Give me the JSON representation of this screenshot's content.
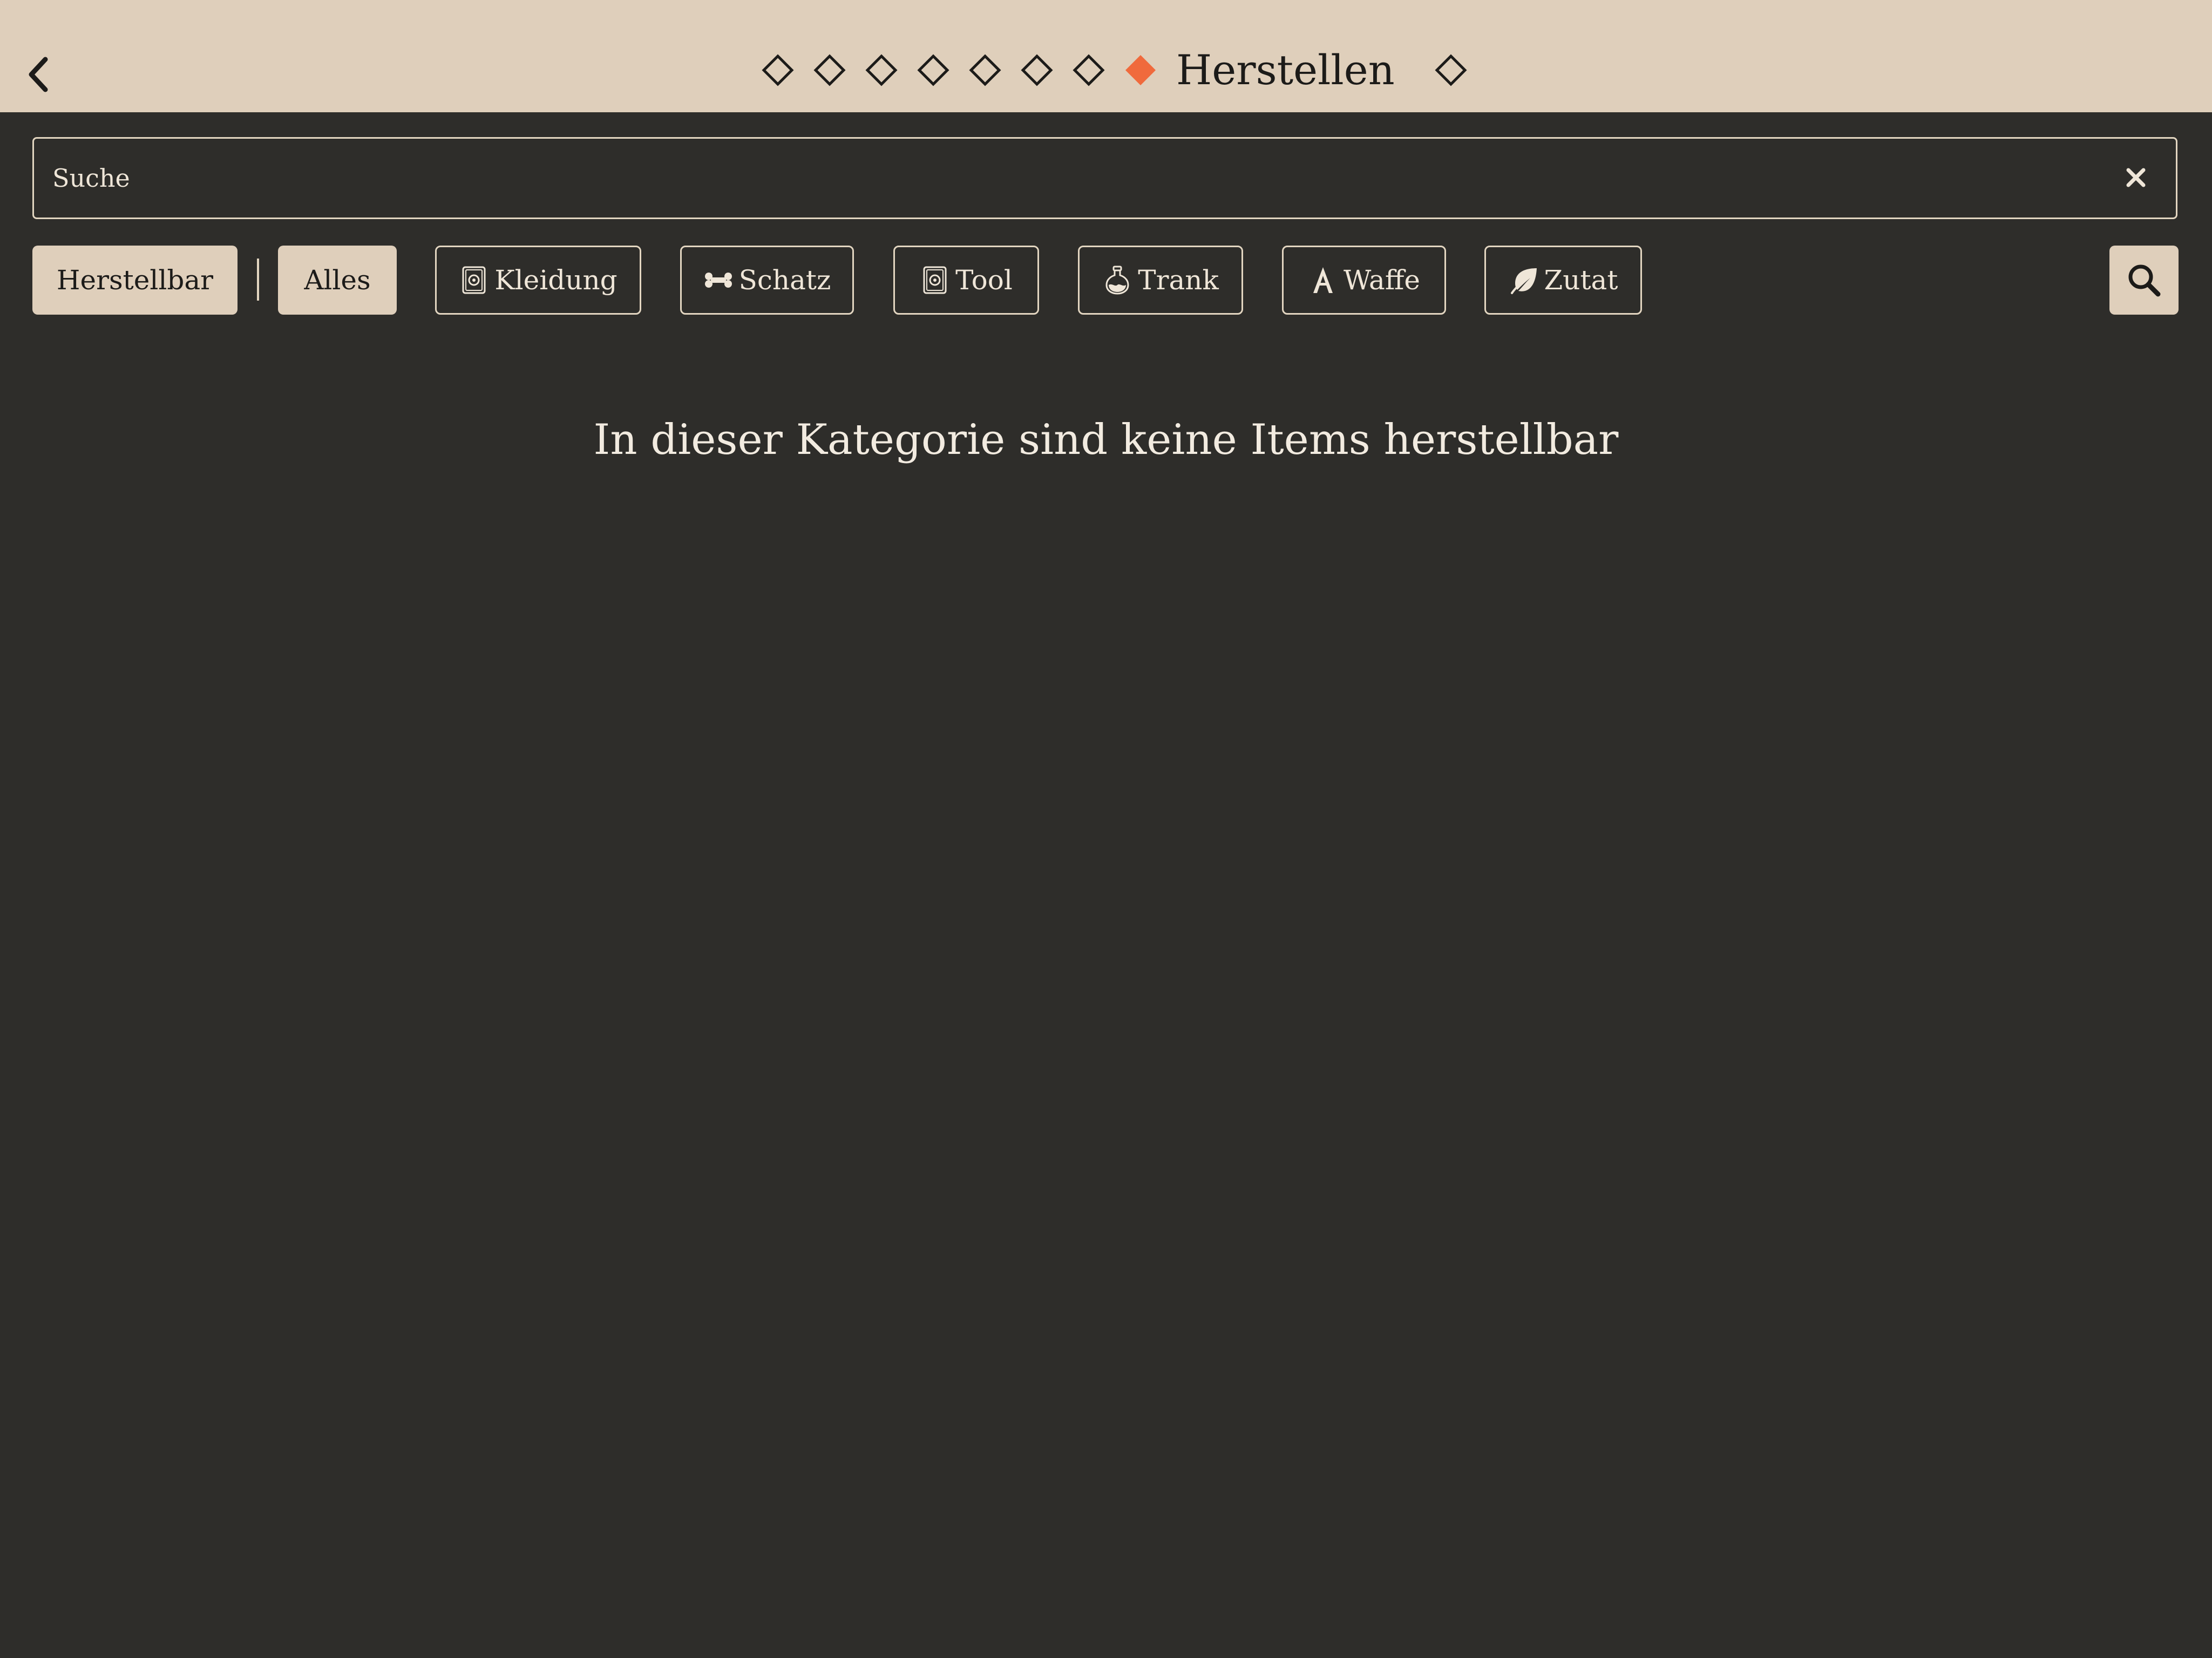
{
  "header": {
    "title": "Herstellen",
    "back_icon": "chevron-left-icon",
    "nav_dots_before": 7,
    "nav_dots_after": 1,
    "active_dot_color": "#f06a3c"
  },
  "search": {
    "placeholder": "Suche",
    "value": "",
    "clear_icon": "close-icon"
  },
  "filters": {
    "craftable": {
      "label": "Herstellbar"
    },
    "all": {
      "label": "Alles"
    },
    "categories": [
      {
        "label": "Kleidung",
        "icon": "clothing-icon"
      },
      {
        "label": "Schatz",
        "icon": "bone-icon"
      },
      {
        "label": "Tool",
        "icon": "tool-icon"
      },
      {
        "label": "Trank",
        "icon": "potion-icon"
      },
      {
        "label": "Waffe",
        "icon": "weapon-icon"
      },
      {
        "label": "Zutat",
        "icon": "leaf-icon"
      }
    ],
    "search_button_icon": "search-icon"
  },
  "main": {
    "empty_message": "In dieser Kategorie sind keine Items herstellbar"
  },
  "colors": {
    "background": "#2e2d2a",
    "header_bg": "#dfcfbb",
    "accent": "#f06a3c",
    "text_light": "#efe6d8",
    "text_dark": "#1c1b19"
  }
}
